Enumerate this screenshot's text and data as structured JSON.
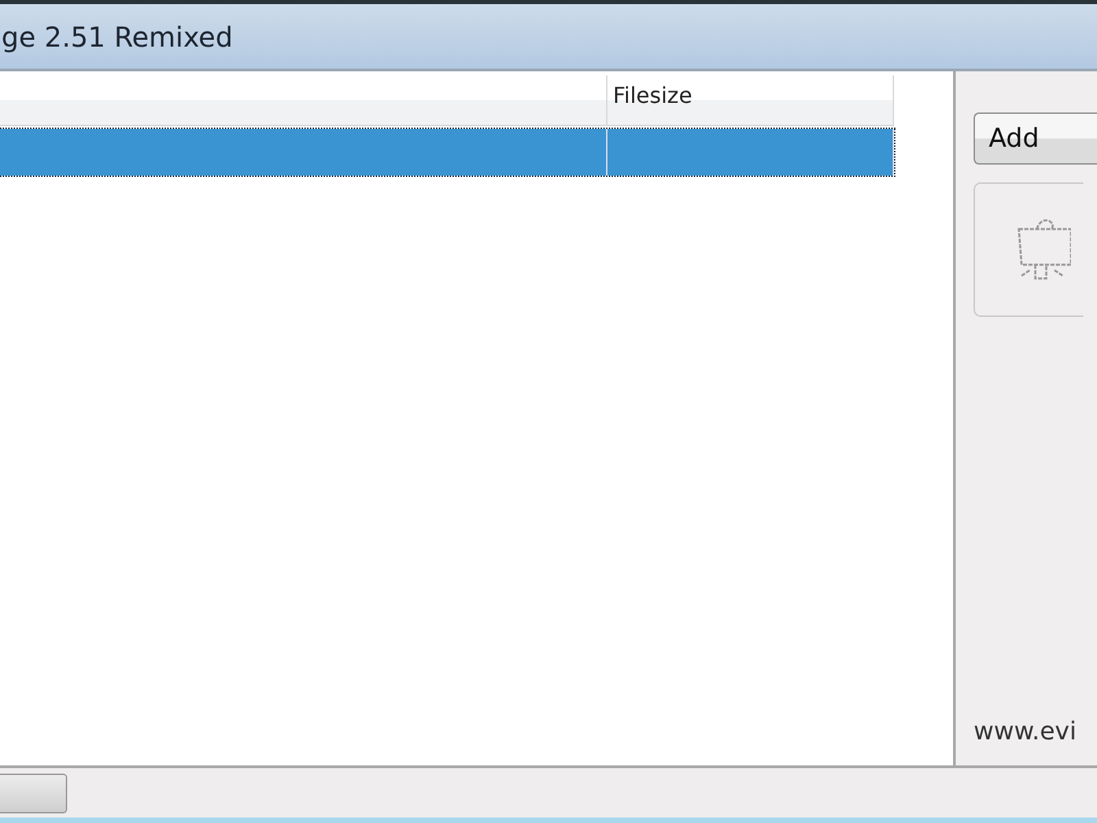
{
  "window": {
    "title": "ge 2.51 Remixed"
  },
  "table": {
    "columns": [
      {},
      {
        "label": "Filesize"
      }
    ],
    "rows": [
      {
        "selected": true
      }
    ]
  },
  "sidebar": {
    "add_button": "Add",
    "link": "www.evi"
  }
}
